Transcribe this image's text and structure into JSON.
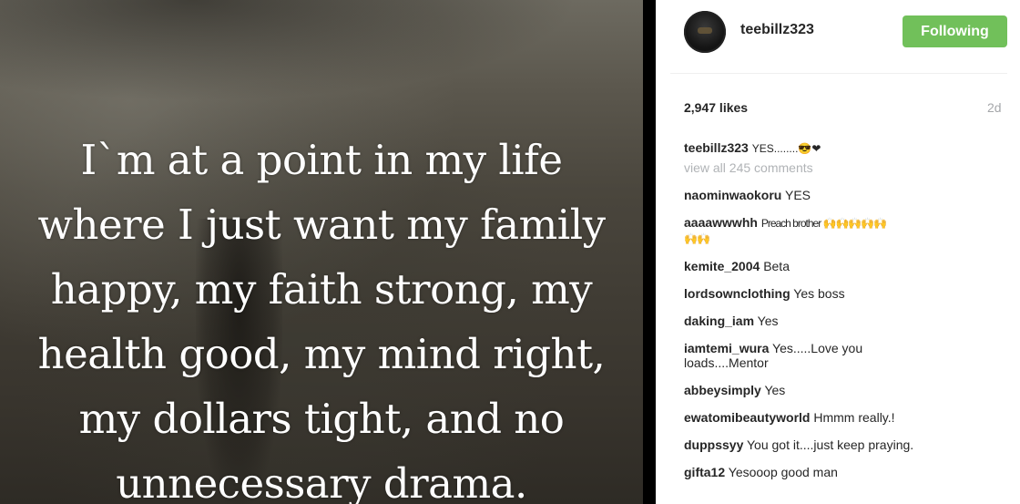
{
  "post": {
    "quote_lines": [
      "I`m at a point in my life",
      "where I just want my family",
      "happy, my faith strong, my",
      "health good, my mind right,",
      "my dollars tight, and no",
      "unnecessary drama."
    ]
  },
  "header": {
    "username": "teebillz323",
    "follow_label": "Following",
    "follow_color": "#71c05a"
  },
  "meta": {
    "likes": "2,947 likes",
    "age": "2d"
  },
  "caption": {
    "user": "teebillz323",
    "text": "YES........😎❤"
  },
  "view_all": "view all 245 comments",
  "comments": [
    {
      "user": "naominwaokoru",
      "text": "YES"
    },
    {
      "user": "aaaawwwhh",
      "text": "Preach brother 🙌🙌🙌🙌🙌",
      "text2": "🙌🙌"
    },
    {
      "user": "kemite_2004",
      "text": "Beta"
    },
    {
      "user": "lordsownclothing",
      "text": "Yes boss"
    },
    {
      "user": "daking_iam",
      "text": "Yes"
    },
    {
      "user": "iamtemi_wura",
      "text": "Yes.....Love you",
      "text2": "loads....Mentor"
    },
    {
      "user": "abbeysimply",
      "text": "Yes"
    },
    {
      "user": "ewatomibeautyworld",
      "text": "Hmmm really.!"
    },
    {
      "user": "duppssyy",
      "text": "You got it....just keep praying."
    },
    {
      "user": "gifta12",
      "text": "Yesooop good man"
    }
  ]
}
